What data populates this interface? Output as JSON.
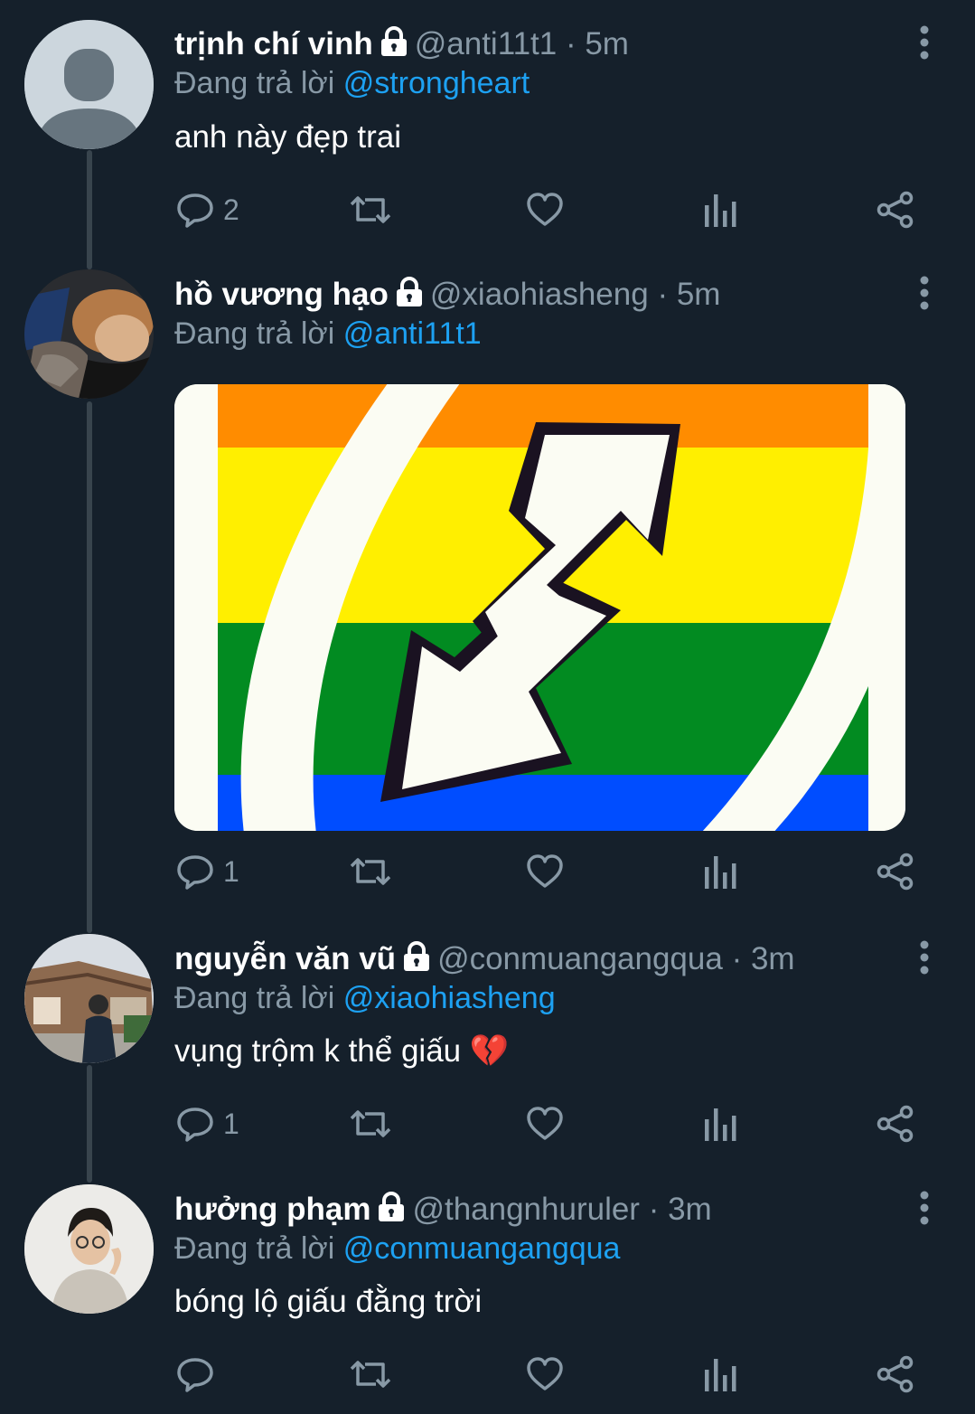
{
  "colors": {
    "background": "#15202b",
    "secondary_text": "#8899a6",
    "mention": "#1da1f2",
    "thread_line": "#38444d"
  },
  "replying_prefix": "Đang trả lời",
  "tweets": [
    {
      "display_name": "trịnh chí vinh",
      "handle": "@anti11t1",
      "separator": "·",
      "time": "5m",
      "reply_to": "@strongheart",
      "text": "anh này đẹp trai",
      "reply_count": "2",
      "avatar": "default-avatar-icon"
    },
    {
      "display_name": "hồ vương hạo",
      "handle": "@xiaohiasheng",
      "separator": "·",
      "time": "5m",
      "reply_to": "@anti11t1",
      "text": "",
      "reply_count": "1",
      "media": "rainbow-uno-reverse-card-image",
      "avatar": "user-photo-avatar"
    },
    {
      "display_name": "nguyễn văn vũ",
      "handle": "@conmuangangqua",
      "separator": "·",
      "time": "3m",
      "reply_to": "@xiaohiasheng",
      "text": "vụng trộm k thể giấu 💔",
      "reply_count": "1",
      "avatar": "user-photo-avatar"
    },
    {
      "display_name": "hưởng phạm",
      "handle": "@thangnhuruler",
      "separator": "·",
      "time": "3m",
      "reply_to": "@conmuangangqua",
      "text": "bóng lộ giấu đằng trời",
      "reply_count": "",
      "avatar": "user-photo-avatar"
    }
  ]
}
